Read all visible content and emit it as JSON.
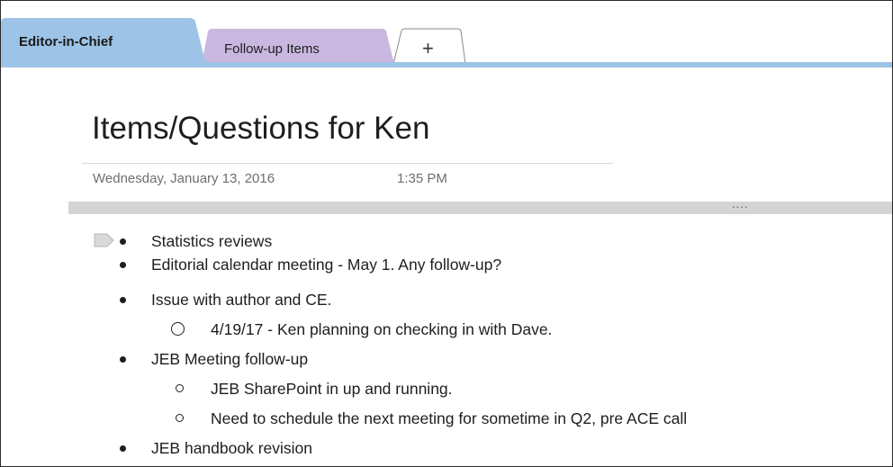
{
  "tabs": [
    {
      "label": "Editor-in-Chief",
      "active": true,
      "color": "#9dc3e6"
    },
    {
      "label": "Follow-up Items",
      "active": false,
      "color": "#c9b7e0"
    },
    {
      "label": "+",
      "active": false,
      "color": "#ffffff"
    }
  ],
  "page": {
    "title": "Items/Questions for Ken",
    "date": "Wednesday, January 13, 2016",
    "time": "1:35 PM",
    "grip": "...."
  },
  "outline": [
    {
      "text": "Statistics reviews",
      "level": 1
    },
    {
      "text": "Editorial calendar meeting - May 1. Any follow-up?",
      "level": 1
    },
    {
      "text": "Issue with author and CE.",
      "level": 1
    },
    {
      "text": "4/19/17 - Ken planning on checking in with Dave.",
      "level": 2,
      "marker": "large-circle"
    },
    {
      "text": "JEB Meeting follow-up",
      "level": 1
    },
    {
      "text": "JEB SharePoint in up and running.",
      "level": 2,
      "marker": "small-circle"
    },
    {
      "text": "Need to schedule the next meeting for sometime in Q2, pre ACE call",
      "level": 2,
      "marker": "small-circle"
    },
    {
      "text": "JEB handbook revision",
      "level": 1
    }
  ],
  "colors": {
    "section_bar": "#9dc3e6",
    "tab_purple": "#c9b7e0",
    "container_bar": "#d4d4d4"
  },
  "icons": [
    "note-tag-icon"
  ]
}
